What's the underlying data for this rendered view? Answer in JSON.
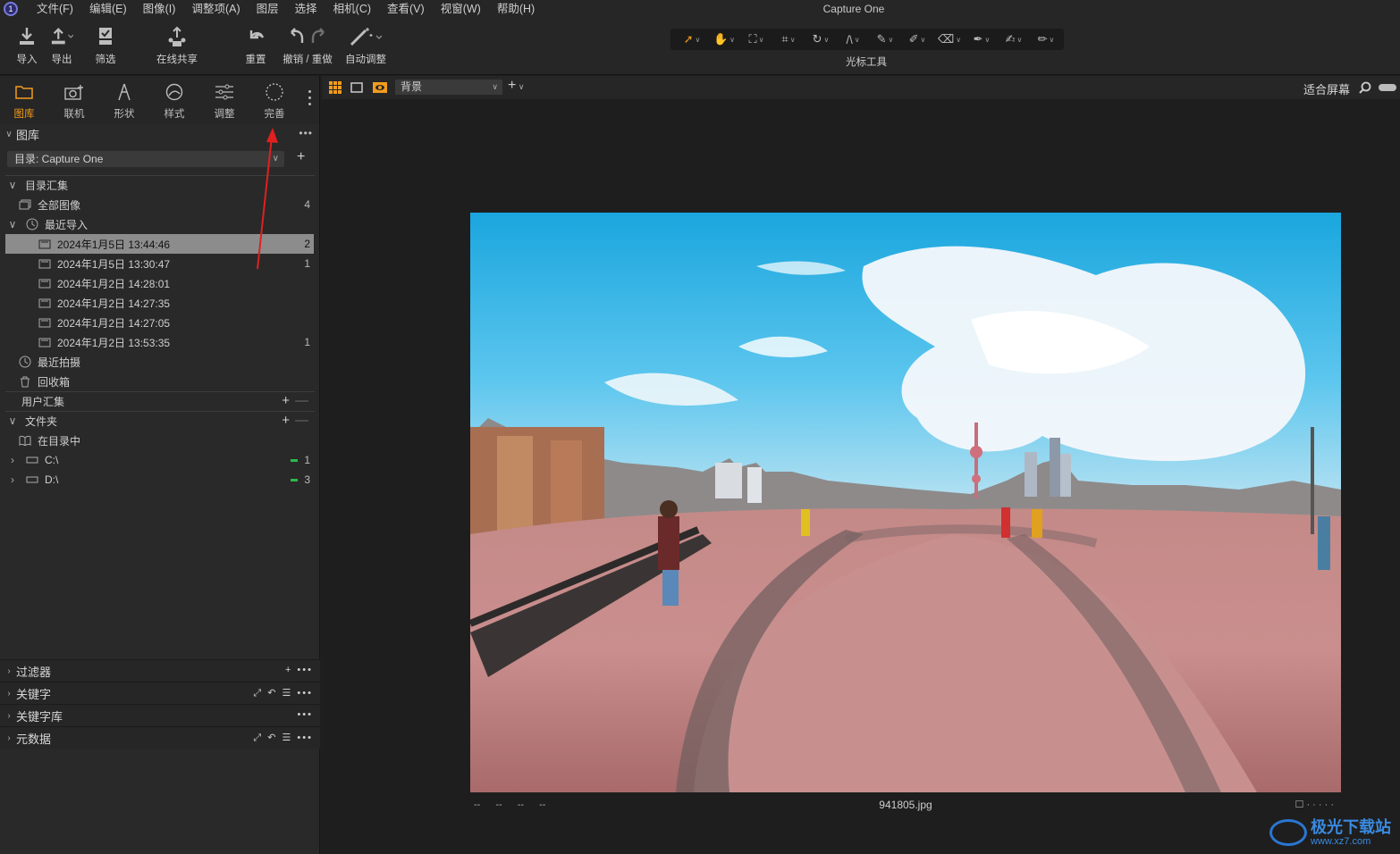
{
  "app": {
    "title": "Capture One"
  },
  "menu": [
    "文件(F)",
    "编辑(E)",
    "图像(I)",
    "调整项(A)",
    "图层",
    "选择",
    "相机(C)",
    "查看(V)",
    "视窗(W)",
    "帮助(H)"
  ],
  "toolbar": {
    "import": "导入",
    "export": "导出",
    "filter": "筛选",
    "share": "在线共享",
    "reset": "重置",
    "undo_redo": "撤销 / 重做",
    "auto_adjust": "自动调整",
    "cursor_tools": "光标工具"
  },
  "tool_tabs": [
    {
      "label": "图库",
      "icon": "folder-icon",
      "active": true
    },
    {
      "label": "联机",
      "icon": "camera-icon"
    },
    {
      "label": "形状",
      "icon": "lens-icon"
    },
    {
      "label": "样式",
      "icon": "palette-icon"
    },
    {
      "label": "调整",
      "icon": "sliders-icon"
    },
    {
      "label": "完善",
      "icon": "dotted-circle-icon"
    }
  ],
  "library": {
    "header": "图库",
    "catalog": "目录: Capture One",
    "catalog_collections": "目录汇集",
    "all_images": {
      "label": "全部图像",
      "count": "4"
    },
    "recent_imports": "最近导入",
    "imports": [
      {
        "label": "2024年1月5日 13:44:46",
        "count": "2",
        "selected": true
      },
      {
        "label": "2024年1月5日 13:30:47",
        "count": "1"
      },
      {
        "label": "2024年1月2日 14:28:01",
        "count": ""
      },
      {
        "label": "2024年1月2日 14:27:35",
        "count": ""
      },
      {
        "label": "2024年1月2日 14:27:05",
        "count": ""
      },
      {
        "label": "2024年1月2日 13:53:35",
        "count": "1"
      }
    ],
    "recent_captures": "最近拍摄",
    "trash": "回收箱",
    "user_collections": "用户汇集",
    "folders": "文件夹",
    "in_catalog": "在目录中",
    "drives": [
      {
        "label": "C:\\",
        "count": "1"
      },
      {
        "label": "D:\\",
        "count": "3"
      }
    ]
  },
  "bottom_sections": [
    "过滤器",
    "关键字",
    "关键字库",
    "元数据"
  ],
  "viewer": {
    "background": "背景",
    "fit": "适合屏幕",
    "filename": "941805.jpg",
    "status_left": "-- -- -- --"
  },
  "watermark": {
    "name": "极光下载站",
    "url": "www.xz7.com"
  },
  "colors": {
    "accent": "#f29c1f",
    "selected_row": "#8c8c8c",
    "annotation_arrow": "#e02020"
  }
}
